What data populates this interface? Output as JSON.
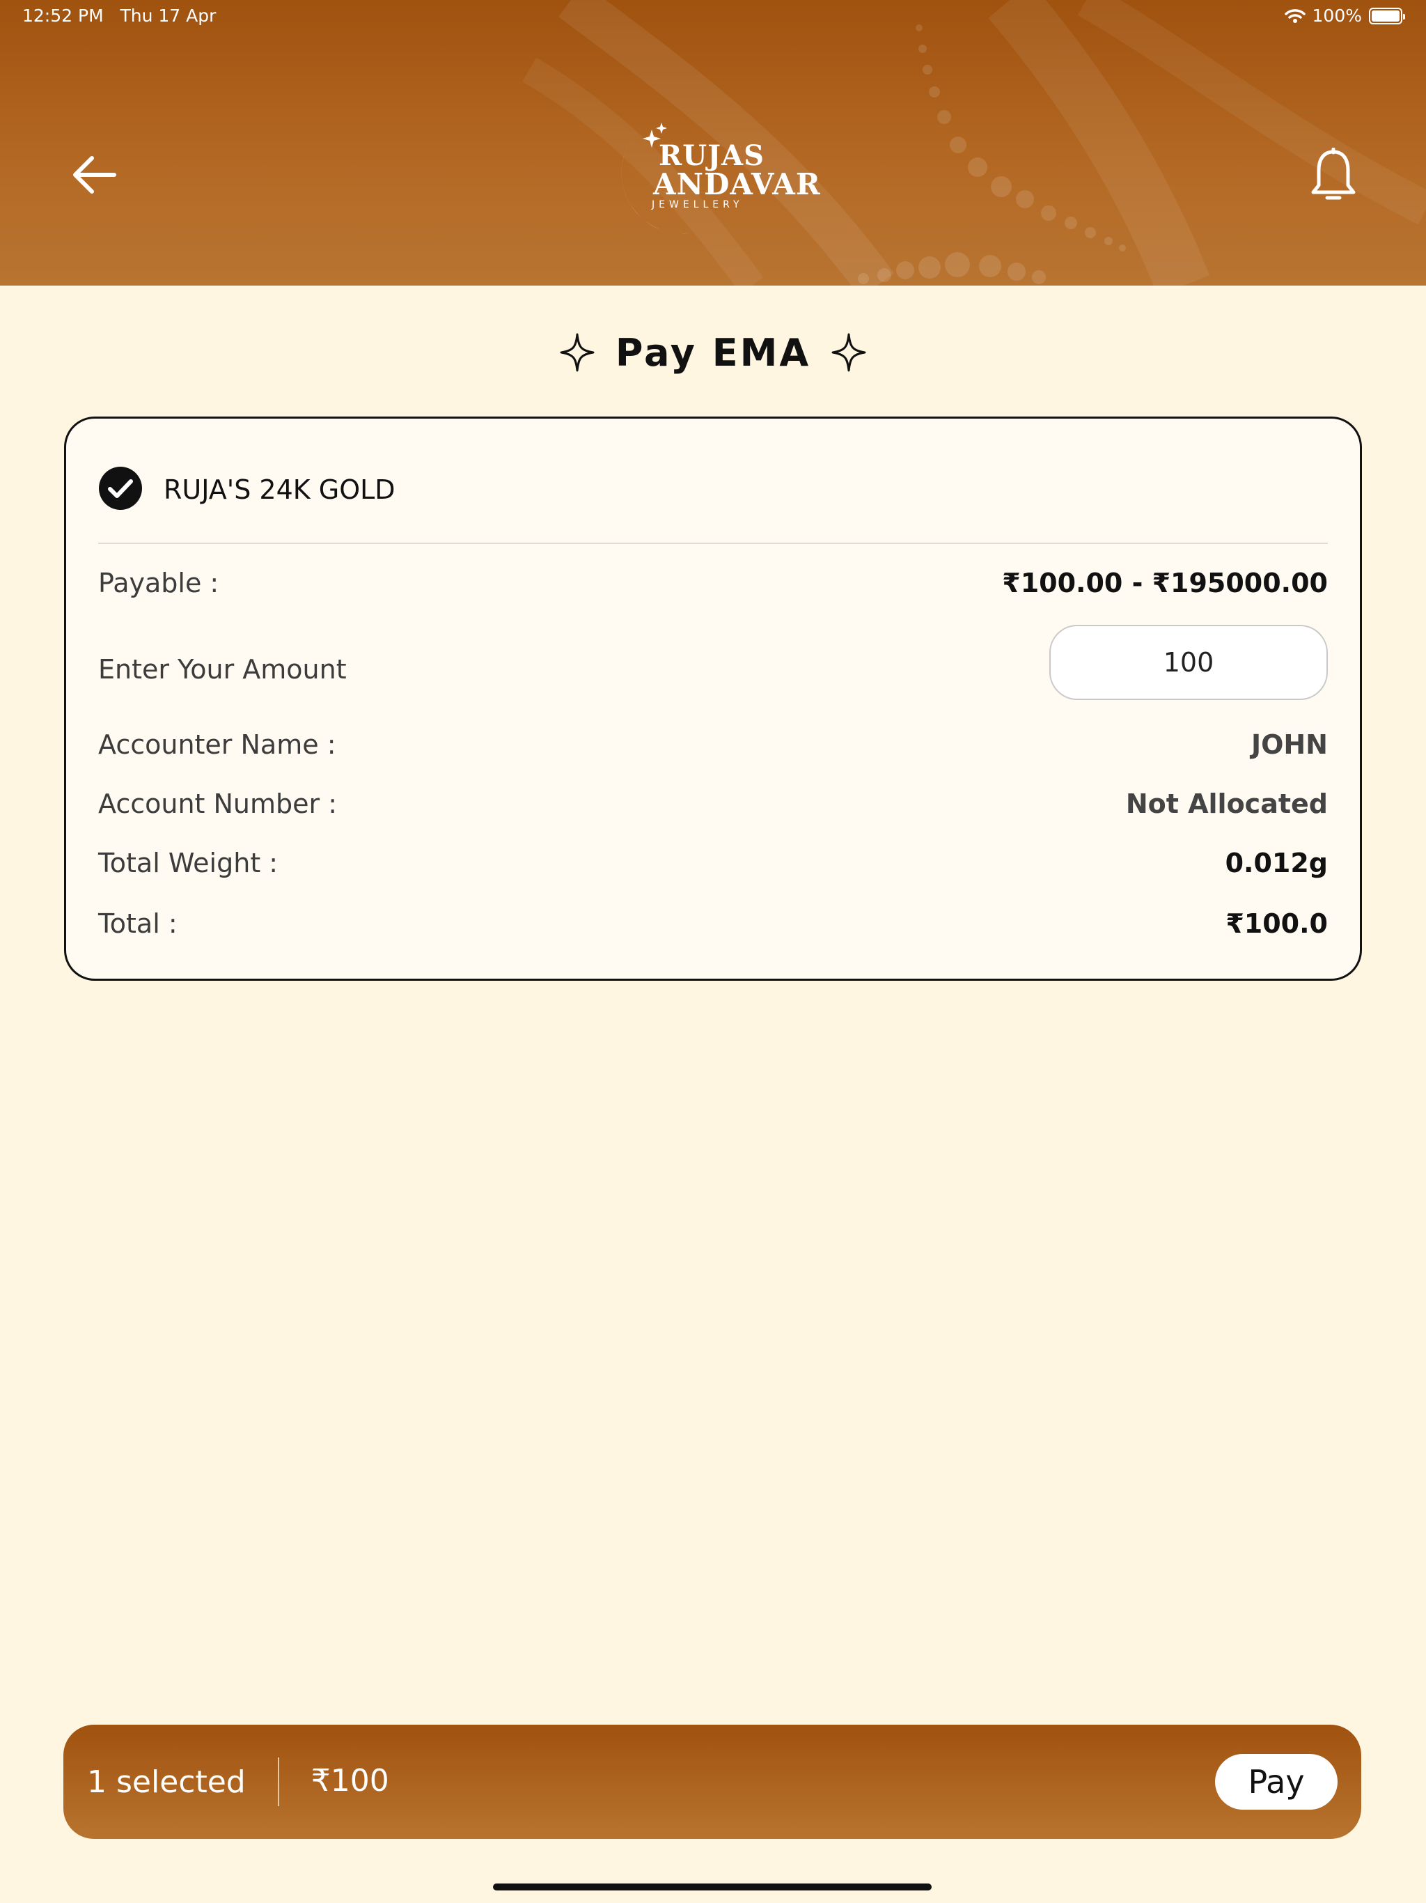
{
  "status_bar": {
    "time": "12:52 PM",
    "date": "Thu 17 Apr",
    "battery": "100%"
  },
  "header": {
    "logo_line1": "RUJAS",
    "logo_line2": "ANDAVAR",
    "logo_line3": "JEWELLERY",
    "back_icon": "arrow-left-icon",
    "bell_icon": "bell-icon"
  },
  "page": {
    "title": "Pay EMA"
  },
  "plan": {
    "name": "RUJA'S 24K GOLD",
    "payable_label": "Payable :",
    "payable_value": "₹100.00 - ₹195000.00",
    "amount_label": "Enter Your Amount",
    "amount_value": "100",
    "accounter_label": "Accounter Name :",
    "accounter_value": "JOHN",
    "account_number_label": "Account Number :",
    "account_number_value": "Not Allocated",
    "weight_label": "Total Weight :",
    "weight_value": "0.012g",
    "total_label": "Total :",
    "total_value": "₹100.0"
  },
  "pay_bar": {
    "selected": "1 selected",
    "amount": "₹100",
    "pay_label": "Pay"
  },
  "colors": {
    "brand": "#a0520f",
    "background": "#fff6e2"
  }
}
